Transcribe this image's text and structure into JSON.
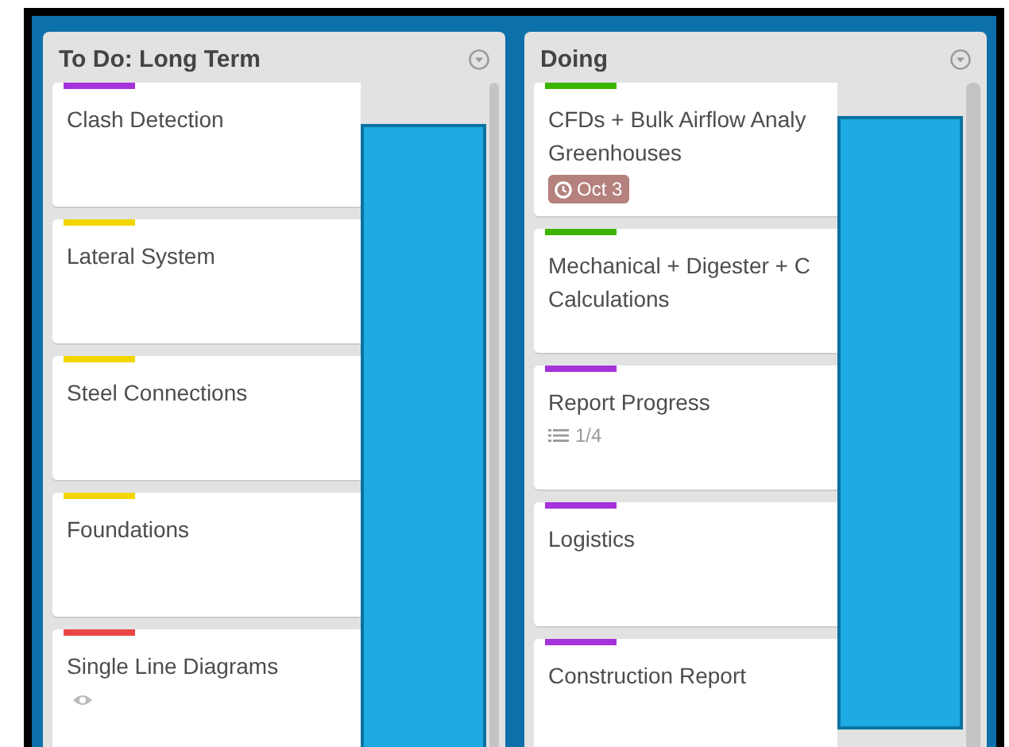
{
  "lists": [
    {
      "title": "To Do: Long Term",
      "cards": [
        {
          "color": "#a632db",
          "title": [
            "Clash Detection"
          ]
        },
        {
          "color": "#f2d600",
          "title": [
            "Lateral System"
          ]
        },
        {
          "color": "#f2d600",
          "title": [
            "Steel Connections"
          ]
        },
        {
          "color": "#f2d600",
          "title": [
            "Foundations"
          ]
        },
        {
          "color": "#eb4646",
          "title": [
            "Single Line Diagrams"
          ],
          "badges": [
            {
              "kind": "watch"
            }
          ]
        }
      ]
    },
    {
      "title": "Doing",
      "cards": [
        {
          "color": "#3cb500",
          "title": [
            "CFDs + Bulk Airflow Analy",
            "Greenhouses"
          ],
          "badges": [
            {
              "kind": "due",
              "text": "Oct 3"
            }
          ]
        },
        {
          "color": "#3cb500",
          "title": [
            "Mechanical + Digester + C",
            "Calculations"
          ]
        },
        {
          "color": "#a632db",
          "title": [
            "Report Progress"
          ],
          "badges": [
            {
              "kind": "checklist",
              "text": "1/4"
            }
          ]
        },
        {
          "color": "#a632db",
          "title": [
            "Logistics"
          ]
        },
        {
          "color": "#a632db",
          "title": [
            "Construction Report"
          ]
        }
      ]
    }
  ]
}
